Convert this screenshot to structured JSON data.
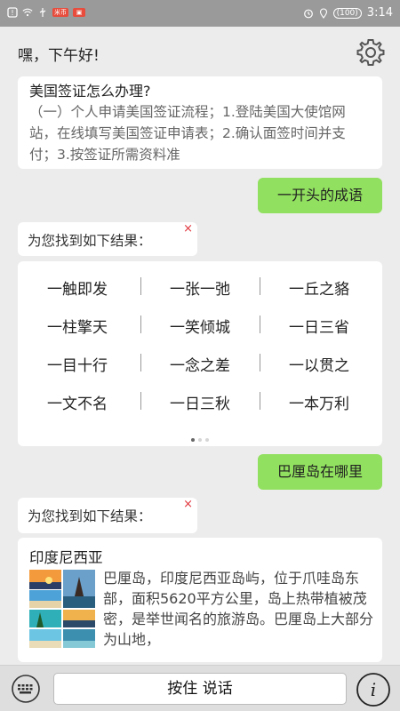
{
  "status_bar": {
    "badge_a": "米币",
    "battery": "100",
    "time": "3:14"
  },
  "header": {
    "greeting": "嘿，下午好!"
  },
  "visa_card": {
    "title": "美国签证怎么办理?",
    "body": "（一）个人申请美国签证流程；1.登陆美国大使馆网站，在线填写美国签证申请表；2.确认面签时间并支付；3.按签证所需资料准"
  },
  "user_message_1": "一开头的成语",
  "found_label_1": "为您找到如下结果：",
  "close_symbol": "×",
  "idioms": [
    [
      "一触即发",
      "一张一弛",
      "一丘之貉"
    ],
    [
      "一柱擎天",
      "一笑倾城",
      "一日三省"
    ],
    [
      "一目十行",
      "一念之差",
      "一以贯之"
    ],
    [
      "一文不名",
      "一日三秋",
      "一本万利"
    ]
  ],
  "user_message_2": "巴厘岛在哪里",
  "found_label_2": "为您找到如下结果：",
  "bali_card": {
    "title": "印度尼西亚",
    "body": "巴厘岛，印度尼西亚岛屿，位于爪哇岛东部，面积5620平方公里，岛上热带植被茂密，是举世闻名的旅游岛。巴厘岛上大部分为山地，"
  },
  "bottom_bar": {
    "talk_label": "按住 说话",
    "info_label": "i"
  },
  "colors": {
    "user_bubble": "#91e05f",
    "close_red": "#e0363d",
    "status_bar": "#9a9a9a"
  }
}
